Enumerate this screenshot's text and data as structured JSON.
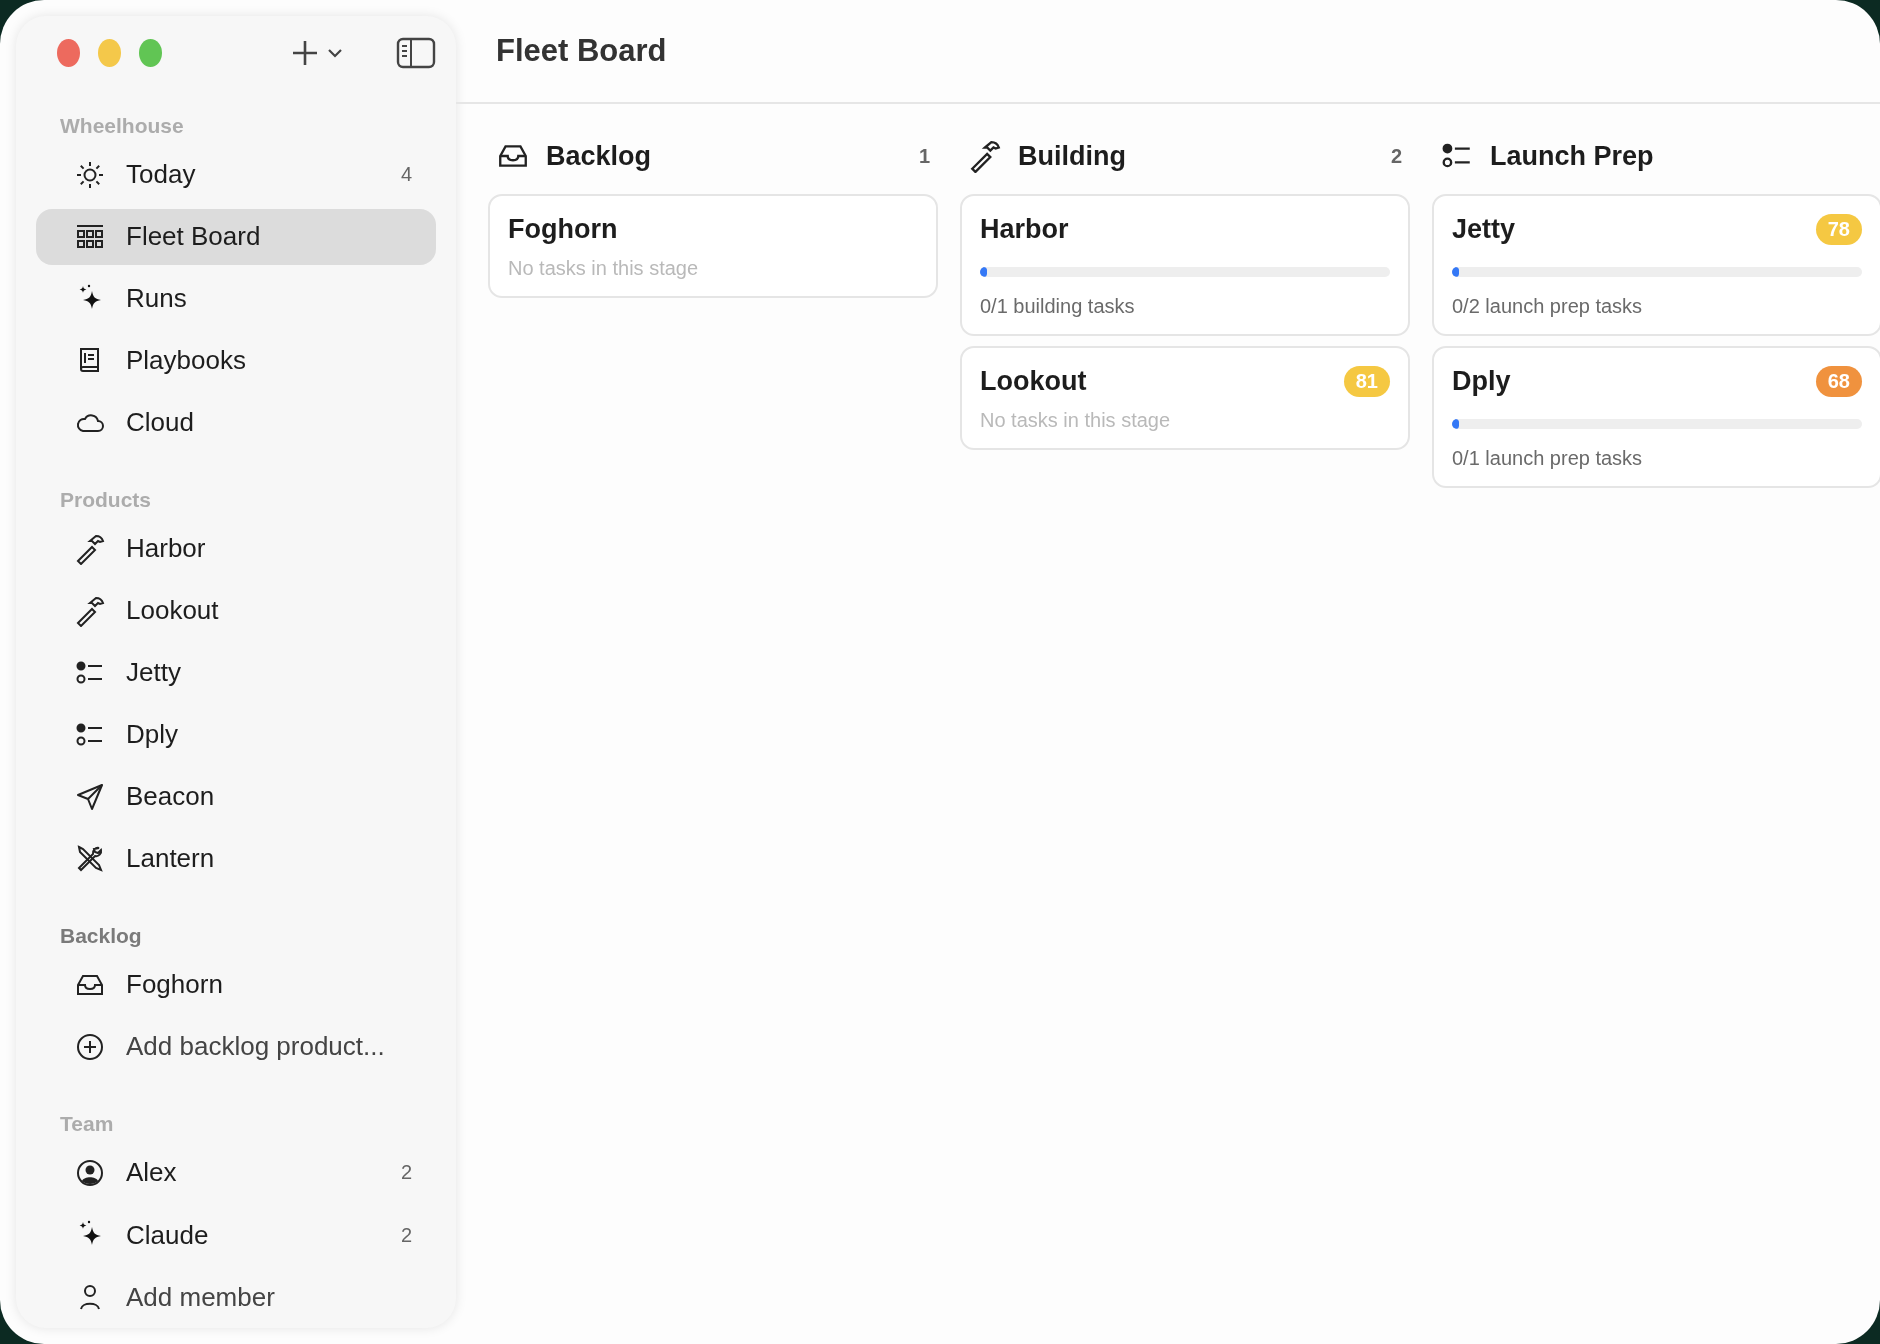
{
  "window": {
    "title": "Fleet Board"
  },
  "sidebar": {
    "sections": [
      {
        "title": "Wheelhouse",
        "items": [
          {
            "label": "Today",
            "count": "4",
            "selected": false
          },
          {
            "label": "Fleet Board",
            "selected": true
          },
          {
            "label": "Runs",
            "selected": false
          },
          {
            "label": "Playbooks",
            "selected": false
          },
          {
            "label": "Cloud",
            "selected": false
          }
        ]
      },
      {
        "title": "Products",
        "items": [
          {
            "label": "Harbor",
            "selected": false
          },
          {
            "label": "Lookout",
            "selected": false
          },
          {
            "label": "Jetty",
            "selected": false
          },
          {
            "label": "Dply",
            "selected": false
          },
          {
            "label": "Beacon",
            "selected": false
          },
          {
            "label": "Lantern",
            "selected": false
          }
        ]
      },
      {
        "title": "Backlog",
        "items": [
          {
            "label": "Foghorn",
            "selected": false
          },
          {
            "label": "Add backlog product...",
            "kind": "add",
            "selected": false
          }
        ]
      },
      {
        "title": "Team",
        "items": [
          {
            "label": "Alex",
            "count": "2",
            "selected": false
          },
          {
            "label": "Claude",
            "count": "2",
            "selected": false
          },
          {
            "label": "Add member",
            "kind": "add",
            "selected": false
          }
        ]
      }
    ]
  },
  "columns": [
    {
      "title": "Backlog",
      "count": "1",
      "cards": [
        {
          "title": "Foghorn",
          "note": "No tasks in this stage"
        }
      ]
    },
    {
      "title": "Building",
      "count": "2",
      "cards": [
        {
          "title": "Harbor",
          "level": 0,
          "note": "0/1 building tasks"
        },
        {
          "title": "Lookout",
          "badge": "81",
          "color": "#f5c842",
          "note": "No tasks in this stage"
        }
      ]
    },
    {
      "title": "Launch Prep",
      "cards": [
        {
          "title": "Jetty",
          "badge": "78",
          "color": "#f5c842",
          "level": 0,
          "note": "0/2 launch prep tasks"
        },
        {
          "title": "Dply",
          "badge": "68",
          "color": "#f0923e",
          "level": 0,
          "note": "0/1 launch prep tasks"
        }
      ]
    }
  ]
}
